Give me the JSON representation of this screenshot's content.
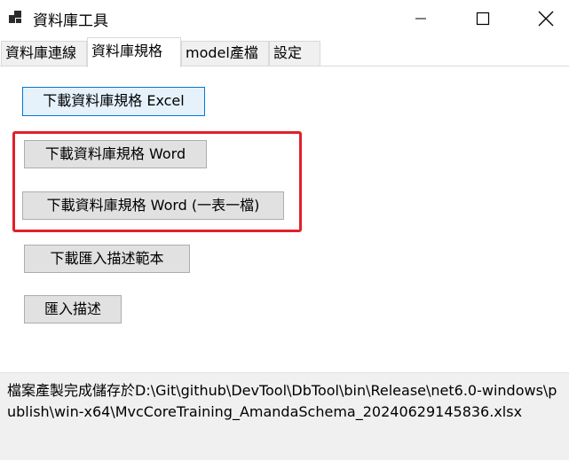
{
  "window": {
    "title": "資料庫工具",
    "controls": {
      "minimize": "minimize",
      "maximize": "maximize",
      "close": "close"
    }
  },
  "tabs": [
    {
      "label": "資料庫連線",
      "active": false
    },
    {
      "label": "資料庫規格",
      "active": true
    },
    {
      "label": "model產檔",
      "active": false
    },
    {
      "label": "設定",
      "active": false
    }
  ],
  "buttons": {
    "excel": "下載資料庫規格 Excel",
    "word": "下載資料庫規格 Word",
    "word_per_table": "下載資料庫規格 Word (一表一檔)",
    "import_template": "下載匯入描述範本",
    "import": "匯入描述"
  },
  "status": {
    "message": "檔案產製完成儲存於D:\\Git\\github\\DevTool\\DbTool\\bin\\Release\\net6.0-windows\\publish\\win-x64\\MvcCoreTraining_AmandaSchema_20240629145836.xlsx"
  },
  "colors": {
    "highlight_border": "#e0202a",
    "focus_border": "#0078d7",
    "button_face": "#e1e1e1",
    "status_bg": "#f0f0f0"
  }
}
